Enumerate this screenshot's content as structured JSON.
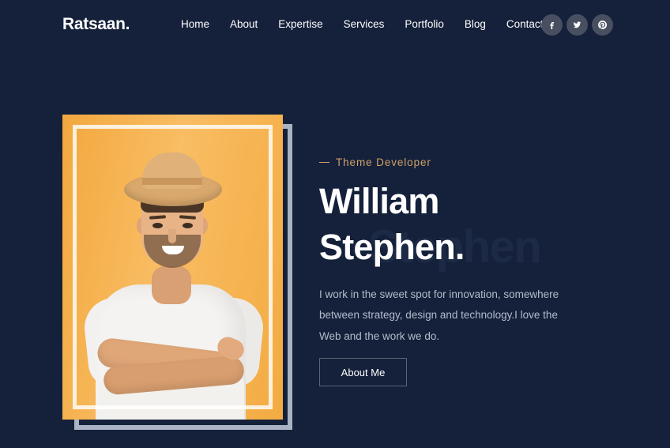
{
  "site": {
    "logo": "Ratsaan.",
    "background_color": "#15213a",
    "accent_color": "#d0a06a",
    "panel_color": "#f5b24f",
    "frame_color": "#aab3c4"
  },
  "nav": {
    "items": [
      {
        "label": "Home"
      },
      {
        "label": "About"
      },
      {
        "label": "Expertise"
      },
      {
        "label": "Services"
      },
      {
        "label": "Portfolio"
      },
      {
        "label": "Blog"
      },
      {
        "label": "Contact"
      }
    ]
  },
  "socials": {
    "items": [
      {
        "name": "facebook-icon",
        "label": "f"
      },
      {
        "name": "twitter-icon",
        "label": "t"
      },
      {
        "name": "pinterest-icon",
        "label": "p"
      }
    ]
  },
  "hero": {
    "eyebrow": "Theme Developer",
    "title_line1": "William",
    "title_line2": "Stephen.",
    "ghost_text": "Stephen",
    "description": "I work in the sweet spot for innovation, somewhere between strategy, design and technology.I love the Web and the work we do.",
    "button_label": "About Me",
    "portrait_alt": "Smiling man in straw hat and white t-shirt with crossed arms"
  }
}
